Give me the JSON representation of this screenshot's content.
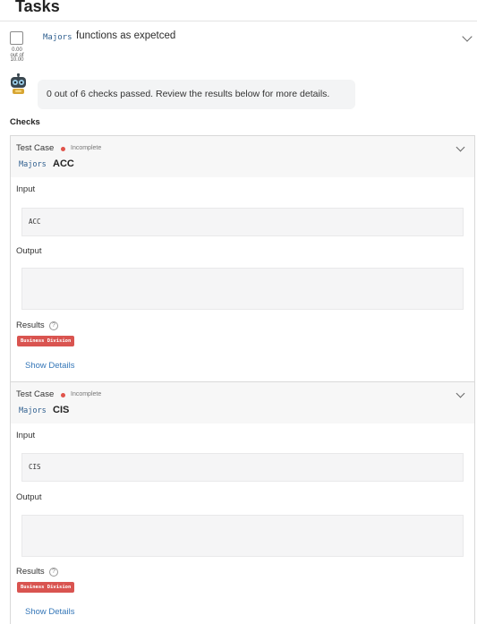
{
  "header": {
    "title": "Tasks"
  },
  "task": {
    "score": [
      "0.00",
      "out of",
      "10.00"
    ],
    "tag": "Majors",
    "description": "functions as expetced"
  },
  "summary": {
    "text": "0 out of 6 checks passed. Review the results below for more details."
  },
  "checks_label": "Checks",
  "test_cases": [
    {
      "label": "Test Case",
      "status": "Incomplete",
      "tag": "Majors",
      "name": "ACC",
      "input_label": "Input",
      "input_value": "ACC",
      "output_label": "Output",
      "output_value": "",
      "results_label": "Results",
      "badge": "Business Division",
      "details_link": "Show Details"
    },
    {
      "label": "Test Case",
      "status": "Incomplete",
      "tag": "Majors",
      "name": "CIS",
      "input_label": "Input",
      "input_value": "CIS",
      "output_label": "Output",
      "output_value": "",
      "results_label": "Results",
      "badge": "Business Division",
      "details_link": "Show Details"
    }
  ],
  "colors": {
    "status_dot": "#e0534a",
    "badge": "#d95450",
    "link": "#3577b8",
    "tag": "#2f5f8f"
  },
  "icons": {
    "expand": "chevron-down-icon",
    "help": "question-circle-icon",
    "assistant": "robot-icon"
  }
}
